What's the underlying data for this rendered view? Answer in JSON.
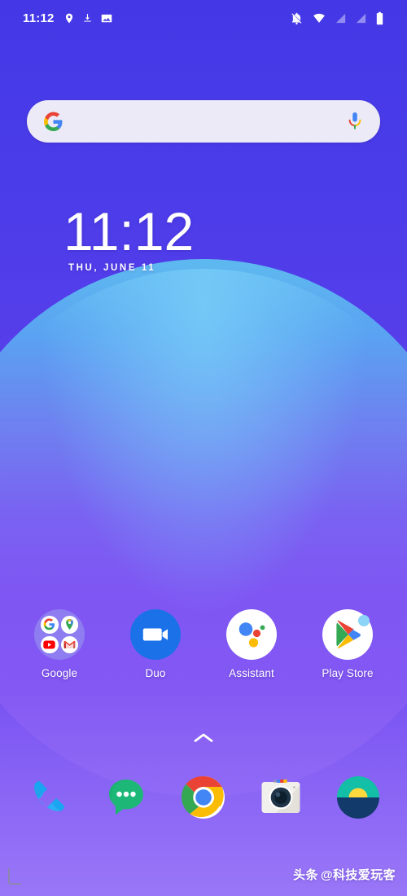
{
  "statusbar": {
    "time": "11:12",
    "left_icons": [
      {
        "name": "location-pin-icon",
        "label": "Location"
      },
      {
        "name": "download-icon",
        "label": "Download"
      },
      {
        "name": "screenshot-image-icon",
        "label": "Screenshot"
      }
    ],
    "right_icons": [
      {
        "name": "notifications-muted-icon",
        "label": "Notifications silenced"
      },
      {
        "name": "wifi-icon",
        "label": "Wi-Fi"
      },
      {
        "name": "signal-sim1-icon",
        "label": "Signal SIM 1"
      },
      {
        "name": "signal-sim2-icon",
        "label": "Signal SIM 2"
      },
      {
        "name": "battery-icon",
        "label": "Battery"
      }
    ]
  },
  "search": {
    "placeholder": "",
    "value": "",
    "google_logo": "google-g-icon",
    "mic": "microphone-icon"
  },
  "clock_widget": {
    "time": "11:12",
    "date": "THU, JUNE 11"
  },
  "apps": [
    {
      "label": "Google",
      "icon": "google-folder-icon",
      "type": "folder",
      "contents": [
        "google-g-icon",
        "google-maps-icon",
        "youtube-icon",
        "gmail-icon"
      ]
    },
    {
      "label": "Duo",
      "icon": "duo-video-icon",
      "type": "app"
    },
    {
      "label": "Assistant",
      "icon": "google-assistant-icon",
      "type": "app"
    },
    {
      "label": "Play Store",
      "icon": "play-store-icon",
      "type": "app",
      "badge": true
    }
  ],
  "drawer": {
    "arrow": "chevron-up-icon",
    "label": "Open app drawer"
  },
  "dock": [
    {
      "icon": "phone-icon",
      "label": "Phone"
    },
    {
      "icon": "messages-icon",
      "label": "Messages"
    },
    {
      "icon": "chrome-icon",
      "label": "Chrome"
    },
    {
      "icon": "camera-icon",
      "label": "Camera"
    },
    {
      "icon": "gallery-sunrise-icon",
      "label": "Gallery"
    }
  ],
  "watermark": {
    "source": "头条",
    "handle": "@科技爱玩客"
  },
  "colors": {
    "wallpaper_top": "#4438e6",
    "wallpaper_bottom": "#8a66f4",
    "circle_top": "#5fc0f0",
    "search_bg": "#eceaf6",
    "duo_blue": "#1b72e8",
    "text_white": "#ffffff"
  }
}
